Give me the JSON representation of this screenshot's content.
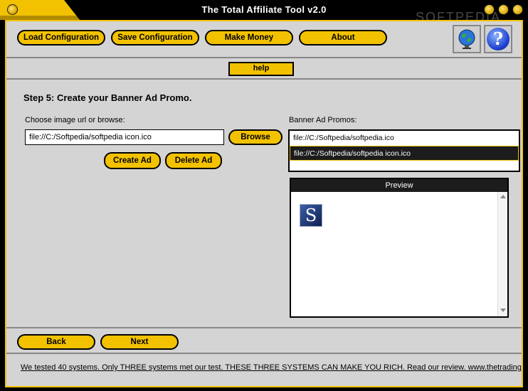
{
  "window": {
    "title": "The Total Affiliate Tool v2.0",
    "watermark": "SOFTPEDIA"
  },
  "toolbar": {
    "load_label": "Load Configuration",
    "save_label": "Save Configuration",
    "money_label": "Make Money",
    "about_label": "About",
    "globe_icon": "globe-icon",
    "help_icon_glyph": "?"
  },
  "helpbar": {
    "help_label": "help"
  },
  "step": {
    "title": "Step 5: Create your Banner Ad Promo.",
    "image_label": "Choose image url or browse:",
    "image_value": "file://C:/Softpedia/softpedia icon.ico",
    "browse_label": "Browse",
    "create_label": "Create Ad",
    "delete_label": "Delete Ad"
  },
  "promos": {
    "label": "Banner Ad Promos:",
    "items": [
      {
        "text": "file://C:/Softpedia/softpedia.ico",
        "selected": false
      },
      {
        "text": "file://C:/Softpedia/softpedia icon.ico",
        "selected": true
      }
    ]
  },
  "preview": {
    "header": "Preview",
    "logo_glyph": "S"
  },
  "nav": {
    "back_label": "Back",
    "next_label": "Next"
  },
  "ticker": {
    "text": "We tested 40 systems. Only THREE systems met our test. THESE THREE SYSTEMS CAN MAKE YOU RICH. Read our review. www.thetradingmas"
  },
  "colors": {
    "accent": "#f2c200",
    "frame_bg": "#d4d4d4",
    "selected_bg": "#1c1c1c"
  }
}
